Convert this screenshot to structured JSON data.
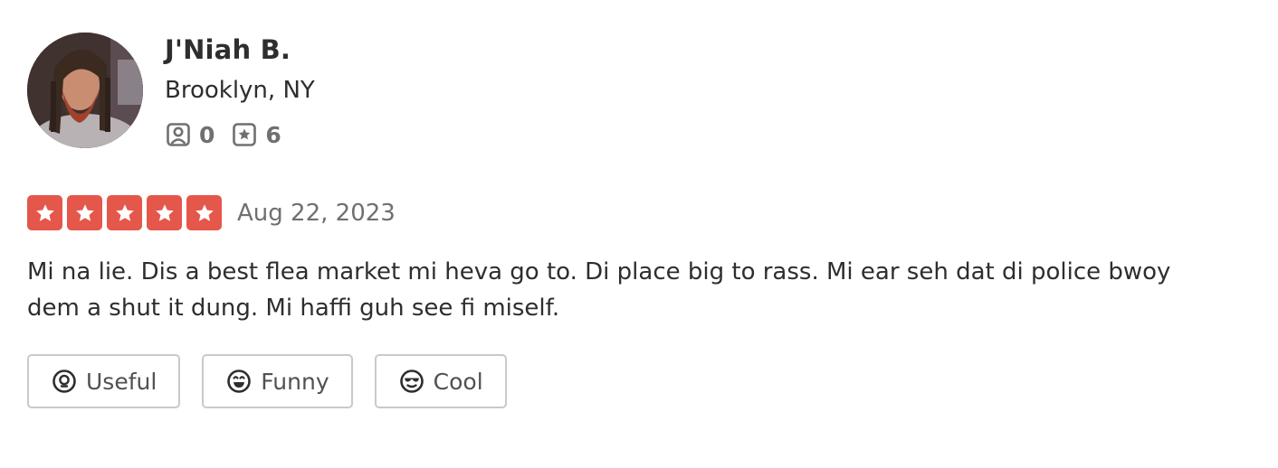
{
  "user": {
    "name": "J'Niah B.",
    "location": "Brooklyn, NY",
    "friends_count": "0",
    "reviews_count": "6",
    "friends_icon": "friends-icon",
    "reviews_icon": "review-star-icon",
    "avatar_alt": "J'Niah B. profile photo"
  },
  "review": {
    "rating": 5,
    "rating_max": 5,
    "star_color": "#e4574a",
    "date": "Aug 22, 2023",
    "text": "Mi na lie. Dis a best flea market mi heva go to. Di place big to rass. Mi ear seh dat di police bwoy dem a shut it dung. Mi haffi guh see fi miself."
  },
  "reactions": [
    {
      "label": "Useful",
      "icon": "lightbulb-icon"
    },
    {
      "label": "Funny",
      "icon": "laughing-face-icon"
    },
    {
      "label": "Cool",
      "icon": "sunglasses-face-icon"
    }
  ]
}
